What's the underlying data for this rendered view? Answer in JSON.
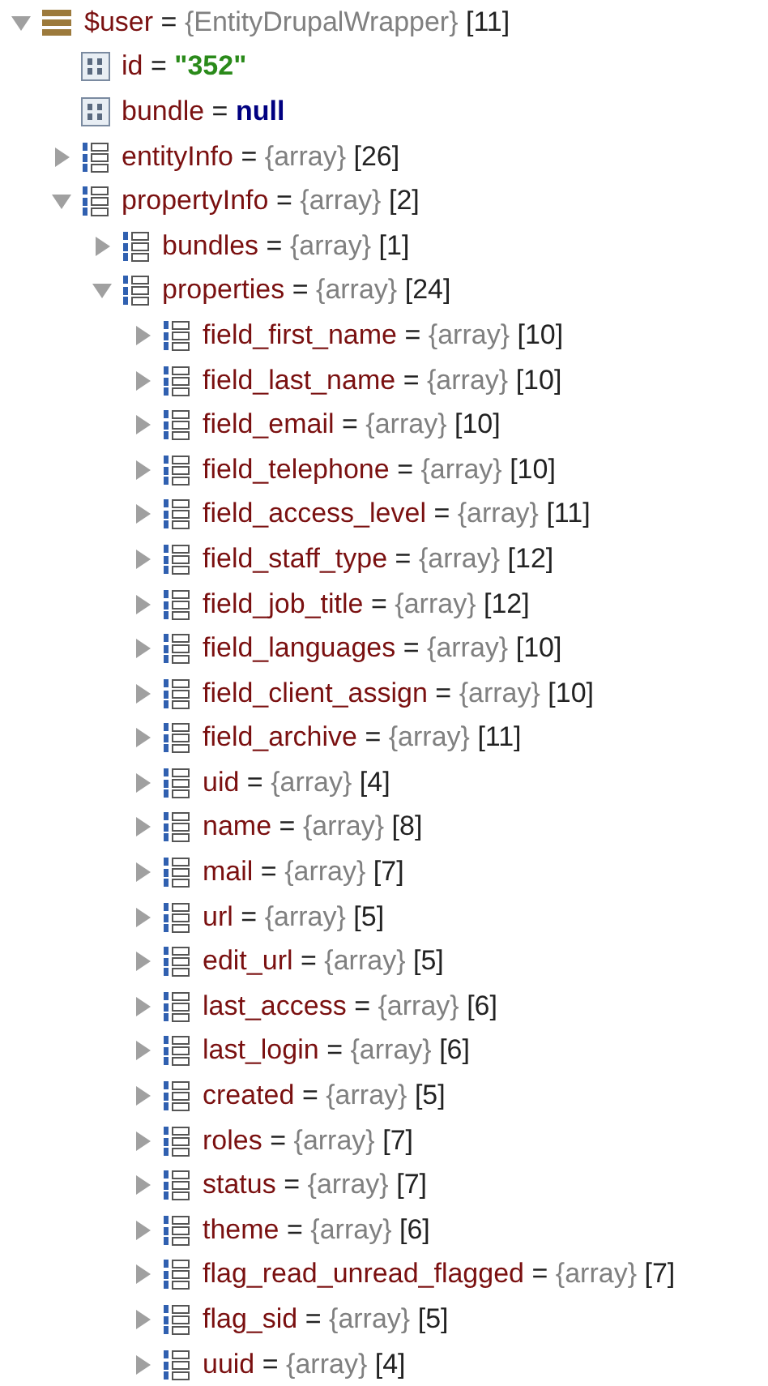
{
  "tree": [
    {
      "name": "$user",
      "eq": "=",
      "kind": "object",
      "type": "{EntityDrupalWrapper}",
      "count": "[11]",
      "expanded": true,
      "children": [
        {
          "name": "id",
          "eq": "=",
          "kind": "string",
          "value": "\"352\""
        },
        {
          "name": "bundle",
          "eq": "=",
          "kind": "null",
          "value": "null"
        },
        {
          "name": "entityInfo",
          "eq": "=",
          "kind": "array",
          "type": "{array}",
          "count": "[26]",
          "expanded": false
        },
        {
          "name": "propertyInfo",
          "eq": "=",
          "kind": "array",
          "type": "{array}",
          "count": "[2]",
          "expanded": true,
          "children": [
            {
              "name": "bundles",
              "eq": "=",
              "kind": "array",
              "type": "{array}",
              "count": "[1]",
              "expanded": false
            },
            {
              "name": "properties",
              "eq": "=",
              "kind": "array",
              "type": "{array}",
              "count": "[24]",
              "expanded": true,
              "children": [
                {
                  "name": "field_first_name",
                  "eq": "=",
                  "kind": "array",
                  "type": "{array}",
                  "count": "[10]",
                  "expanded": false
                },
                {
                  "name": "field_last_name",
                  "eq": "=",
                  "kind": "array",
                  "type": "{array}",
                  "count": "[10]",
                  "expanded": false
                },
                {
                  "name": "field_email",
                  "eq": "=",
                  "kind": "array",
                  "type": "{array}",
                  "count": "[10]",
                  "expanded": false
                },
                {
                  "name": "field_telephone",
                  "eq": "=",
                  "kind": "array",
                  "type": "{array}",
                  "count": "[10]",
                  "expanded": false
                },
                {
                  "name": "field_access_level",
                  "eq": "=",
                  "kind": "array",
                  "type": "{array}",
                  "count": "[11]",
                  "expanded": false
                },
                {
                  "name": "field_staff_type",
                  "eq": "=",
                  "kind": "array",
                  "type": "{array}",
                  "count": "[12]",
                  "expanded": false
                },
                {
                  "name": "field_job_title",
                  "eq": "=",
                  "kind": "array",
                  "type": "{array}",
                  "count": "[12]",
                  "expanded": false
                },
                {
                  "name": "field_languages",
                  "eq": "=",
                  "kind": "array",
                  "type": "{array}",
                  "count": "[10]",
                  "expanded": false
                },
                {
                  "name": "field_client_assign",
                  "eq": "=",
                  "kind": "array",
                  "type": "{array}",
                  "count": "[10]",
                  "expanded": false
                },
                {
                  "name": "field_archive",
                  "eq": "=",
                  "kind": "array",
                  "type": "{array}",
                  "count": "[11]",
                  "expanded": false
                },
                {
                  "name": "uid",
                  "eq": "=",
                  "kind": "array",
                  "type": "{array}",
                  "count": "[4]",
                  "expanded": false
                },
                {
                  "name": "name",
                  "eq": "=",
                  "kind": "array",
                  "type": "{array}",
                  "count": "[8]",
                  "expanded": false
                },
                {
                  "name": "mail",
                  "eq": "=",
                  "kind": "array",
                  "type": "{array}",
                  "count": "[7]",
                  "expanded": false
                },
                {
                  "name": "url",
                  "eq": "=",
                  "kind": "array",
                  "type": "{array}",
                  "count": "[5]",
                  "expanded": false
                },
                {
                  "name": "edit_url",
                  "eq": "=",
                  "kind": "array",
                  "type": "{array}",
                  "count": "[5]",
                  "expanded": false
                },
                {
                  "name": "last_access",
                  "eq": "=",
                  "kind": "array",
                  "type": "{array}",
                  "count": "[6]",
                  "expanded": false
                },
                {
                  "name": "last_login",
                  "eq": "=",
                  "kind": "array",
                  "type": "{array}",
                  "count": "[6]",
                  "expanded": false
                },
                {
                  "name": "created",
                  "eq": "=",
                  "kind": "array",
                  "type": "{array}",
                  "count": "[5]",
                  "expanded": false
                },
                {
                  "name": "roles",
                  "eq": "=",
                  "kind": "array",
                  "type": "{array}",
                  "count": "[7]",
                  "expanded": false
                },
                {
                  "name": "status",
                  "eq": "=",
                  "kind": "array",
                  "type": "{array}",
                  "count": "[7]",
                  "expanded": false
                },
                {
                  "name": "theme",
                  "eq": "=",
                  "kind": "array",
                  "type": "{array}",
                  "count": "[6]",
                  "expanded": false
                },
                {
                  "name": "flag_read_unread_flagged",
                  "eq": "=",
                  "kind": "array",
                  "type": "{array}",
                  "count": "[7]",
                  "expanded": false
                },
                {
                  "name": "flag_sid",
                  "eq": "=",
                  "kind": "array",
                  "type": "{array}",
                  "count": "[5]",
                  "expanded": false
                },
                {
                  "name": "uuid",
                  "eq": "=",
                  "kind": "array",
                  "type": "{array}",
                  "count": "[4]",
                  "expanded": false
                }
              ]
            }
          ]
        }
      ]
    }
  ]
}
